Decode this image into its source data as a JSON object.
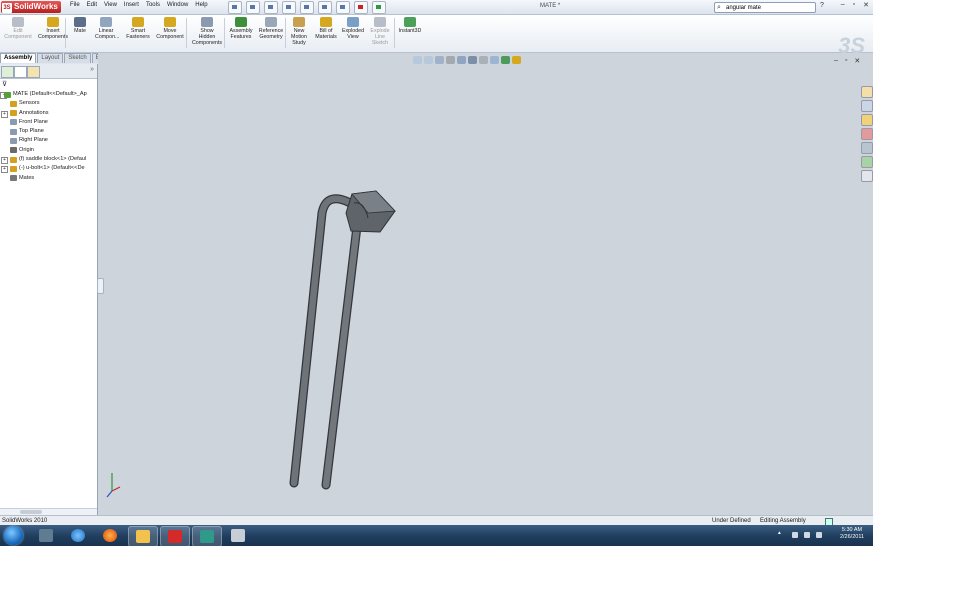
{
  "app": {
    "name": "SolidWorks",
    "window_title": "MATE *",
    "menu": [
      "File",
      "Edit",
      "View",
      "Insert",
      "Tools",
      "Window",
      "Help"
    ],
    "search_value": "angular mate",
    "help_label": "?"
  },
  "commands": [
    {
      "label": "Edit\nComponent",
      "dim": true
    },
    {
      "label": "Insert\nComponents"
    },
    {
      "label": "Mate"
    },
    {
      "label": "Linear\nCompon..."
    },
    {
      "label": "Smart\nFasteners"
    },
    {
      "label": "Move\nComponent"
    },
    {
      "label": "Show\nHidden\nComponents"
    },
    {
      "label": "Assembly\nFeatures"
    },
    {
      "label": "Reference\nGeometry"
    },
    {
      "label": "New\nMotion\nStudy"
    },
    {
      "label": "Bill of\nMaterials"
    },
    {
      "label": "Exploded\nView"
    },
    {
      "label": "Explode\nLine\nSketch",
      "dim": true
    },
    {
      "label": "Instant3D"
    }
  ],
  "tabs": [
    "Assembly",
    "Layout",
    "Sketch",
    "Evaluate"
  ],
  "active_tab": "Assembly",
  "tree": [
    {
      "label": "MATE  (Default<<Default>_Ap",
      "expander": "-",
      "color": "#5a9e3a",
      "indent": 0
    },
    {
      "label": "Sensors",
      "color": "#d4a020",
      "indent": 1
    },
    {
      "label": "Annotations",
      "expander": "+",
      "color": "#d4a020",
      "indent": 1
    },
    {
      "label": "Front Plane",
      "color": "#8a9bb0",
      "indent": 1
    },
    {
      "label": "Top Plane",
      "color": "#8a9bb0",
      "indent": 1
    },
    {
      "label": "Right Plane",
      "color": "#8a9bb0",
      "indent": 1
    },
    {
      "label": "Origin",
      "color": "#6a6a6a",
      "indent": 1
    },
    {
      "label": "(f) saddle block<1> (Defaul",
      "expander": "+",
      "color": "#d4a020",
      "indent": 1
    },
    {
      "label": "(-) u-bolt<1> (Default<<De",
      "expander": "+",
      "color": "#d4a020",
      "indent": 1
    },
    {
      "label": "Mates",
      "color": "#777777",
      "indent": 1
    }
  ],
  "status": {
    "app_label": "SolidWorks 2010",
    "definition": "Under Defined",
    "mode": "Editing Assembly"
  },
  "clock": {
    "time": "5:30 AM",
    "date": "2/26/2011"
  },
  "colors": {
    "part_fill": "#6e737a",
    "part_edge": "#33363b",
    "viewport_bg": "#ced4dc",
    "accent": "#c22b2b"
  }
}
